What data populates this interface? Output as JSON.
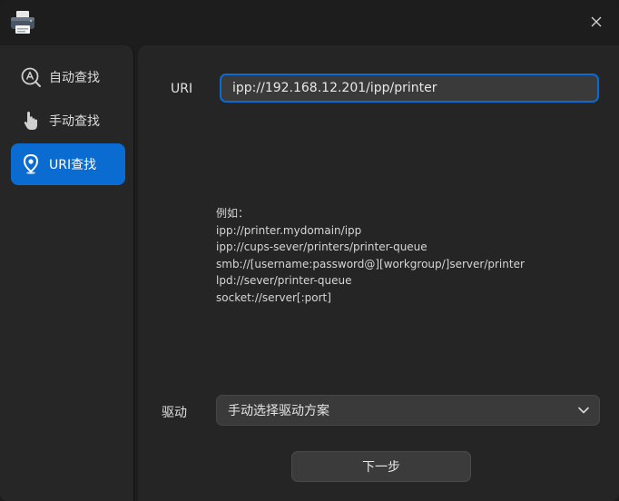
{
  "titlebar": {
    "app_icon": "printer-icon",
    "close_icon": "close-icon"
  },
  "sidebar": {
    "items": [
      {
        "label": "自动查找",
        "icon": "auto-search-icon",
        "active": false
      },
      {
        "label": "手动查找",
        "icon": "hand-pointer-icon",
        "active": false
      },
      {
        "label": "URI查找",
        "icon": "location-pin-icon",
        "active": true
      }
    ]
  },
  "form": {
    "uri_label": "URI",
    "uri_value": "ipp://192.168.12.201/ipp/printer",
    "examples": [
      "例如：",
      "ipp://printer.mydomain/ipp",
      "ipp://cups-sever/printers/printer-queue",
      "smb://[username:password@][workgroup/]server/printer",
      "lpd://sever/printer-queue",
      "socket://server[:port]"
    ],
    "driver_label": "驱动",
    "driver_value": "手动选择驱动方案",
    "next_label": "下一步"
  },
  "colors": {
    "accent": "#0a6bd1",
    "background": "#1d1d1d",
    "panel": "#252525",
    "sidebar": "#262626"
  }
}
